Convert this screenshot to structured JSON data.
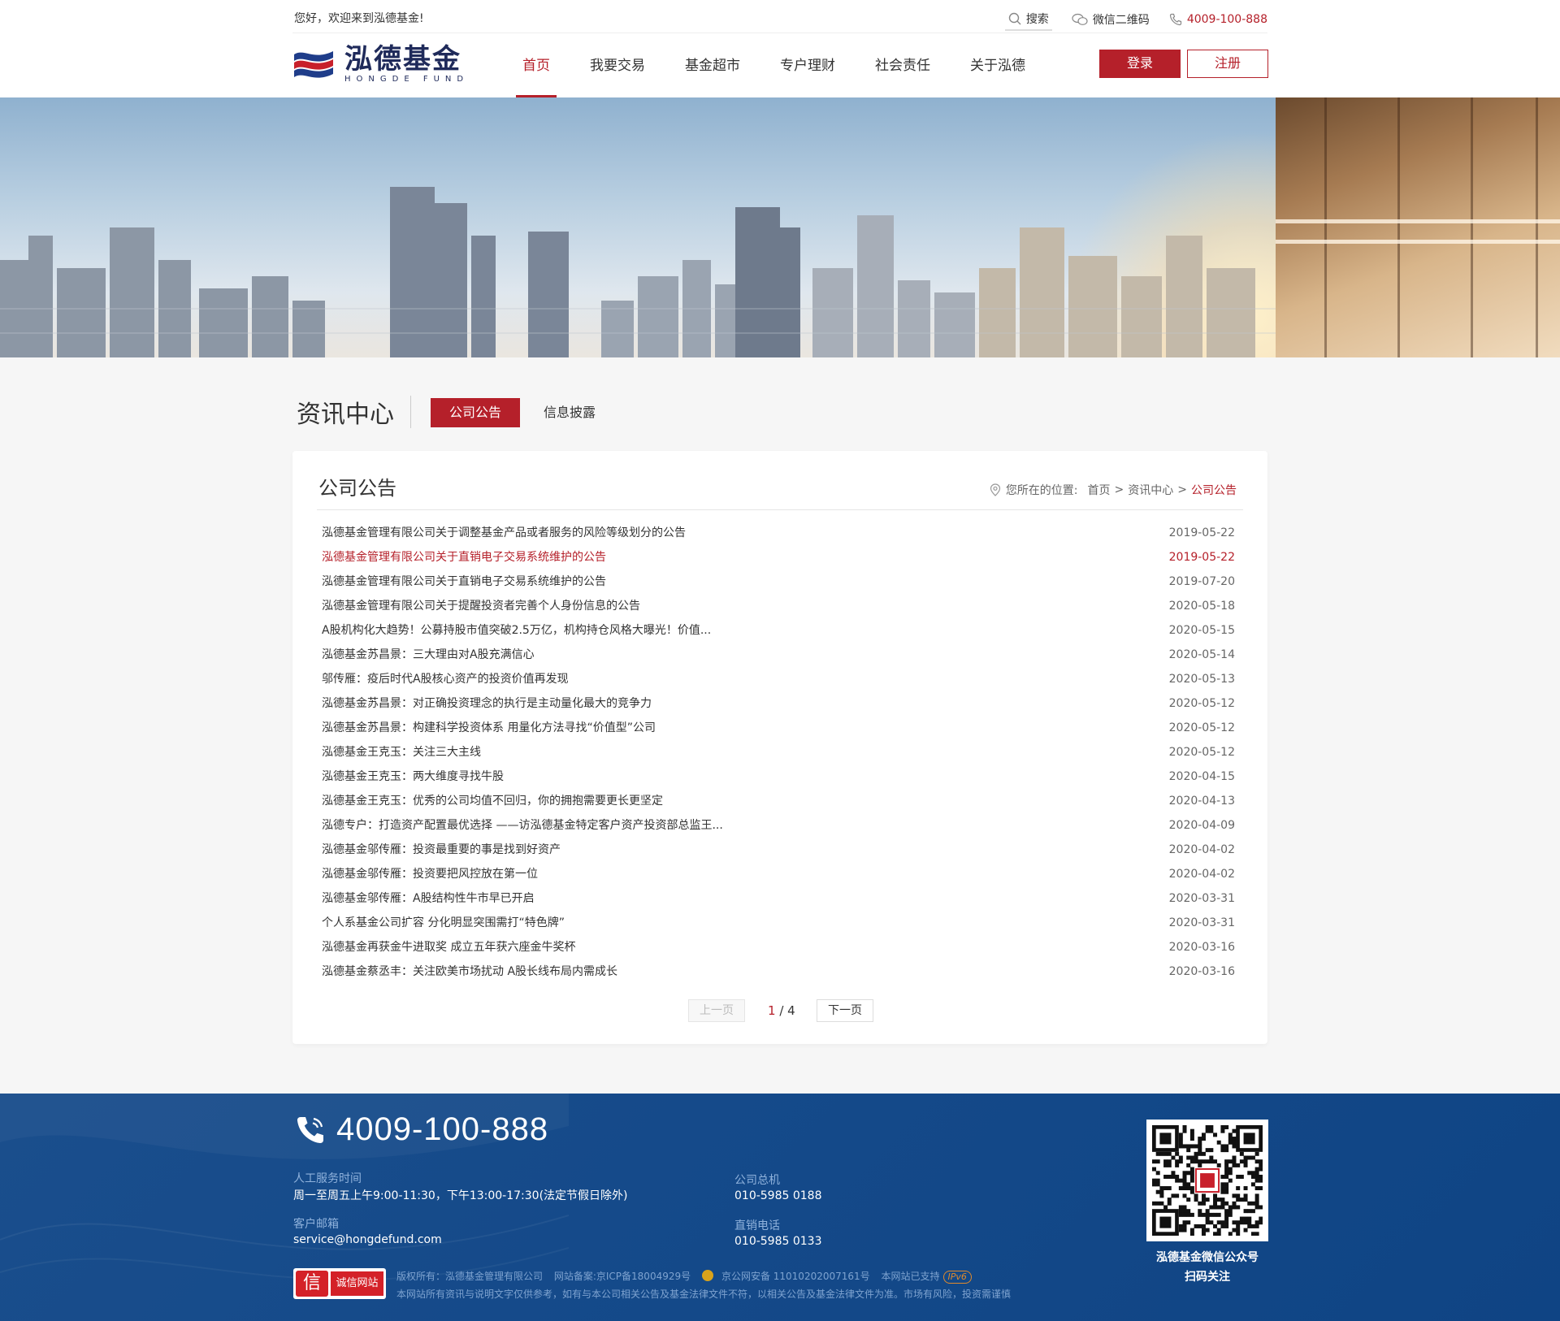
{
  "header": {
    "welcome": "您好，欢迎来到泓德基金!",
    "search_label": "搜索",
    "wechat_label": "微信二维码",
    "phone": "4009-100-888",
    "logo_cn": "泓德基金",
    "logo_en": "HONGDE FUND",
    "nav": [
      "首页",
      "我要交易",
      "基金超市",
      "专户理财",
      "社会责任",
      "关于泓德"
    ],
    "active_nav": "首页",
    "login_label": "登录",
    "register_label": "注册",
    "accent_color": "#b5202a"
  },
  "section": {
    "title": "资讯中心",
    "tabs": [
      "公司公告",
      "信息披露"
    ]
  },
  "card": {
    "title": "公司公告",
    "breadcrumb": {
      "prefix": "您所在的位置:",
      "home": "首页",
      "sep": ">",
      "middle": "资讯中心",
      "current": "公司公告"
    },
    "items": [
      {
        "title": "泓德基金管理有限公司关于调整基金产品或者服务的风险等级划分的公告",
        "date": "2019-05-22"
      },
      {
        "title": "泓德基金管理有限公司关于直销电子交易系统维护的公告",
        "date": "2019-05-22"
      },
      {
        "title": "泓德基金管理有限公司关于直销电子交易系统维护的公告",
        "date": "2019-07-20"
      },
      {
        "title": "泓德基金管理有限公司关于提醒投资者完善个人身份信息的公告",
        "date": "2020-05-18"
      },
      {
        "title": "A股机构化大趋势！公募持股市值突破2.5万亿，机构持仓风格大曝光！价值...",
        "date": "2020-05-15"
      },
      {
        "title": "泓德基金苏昌景：三大理由对A股充满信心",
        "date": "2020-05-14"
      },
      {
        "title": "邬传雁：疫后时代A股核心资产的投资价值再发现",
        "date": "2020-05-13"
      },
      {
        "title": "泓德基金苏昌景：对正确投资理念的执行是主动量化最大的竞争力",
        "date": "2020-05-12"
      },
      {
        "title": "泓德基金苏昌景：构建科学投资体系 用量化方法寻找“价值型”公司",
        "date": "2020-05-12"
      },
      {
        "title": "泓德基金王克玉：关注三大主线",
        "date": "2020-05-12"
      },
      {
        "title": "泓德基金王克玉：两大维度寻找牛股",
        "date": "2020-04-15"
      },
      {
        "title": "泓德基金王克玉：优秀的公司均值不回归，你的拥抱需要更长更坚定",
        "date": "2020-04-13"
      },
      {
        "title": "泓德专户：打造资产配置最优选择 ——访泓德基金特定客户资产投资部总监王...",
        "date": "2020-04-09"
      },
      {
        "title": "泓德基金邬传雁：投资最重要的事是找到好资产",
        "date": "2020-04-02"
      },
      {
        "title": "泓德基金邬传雁：投资要把风控放在第一位",
        "date": "2020-04-02"
      },
      {
        "title": "泓德基金邬传雁：A股结构性牛市早已开启",
        "date": "2020-03-31"
      },
      {
        "title": "个人系基金公司扩容 分化明显突围需打“特色牌”",
        "date": "2020-03-31"
      },
      {
        "title": "泓德基金再获金牛进取奖 成立五年获六座金牛奖杯",
        "date": "2020-03-16"
      },
      {
        "title": "泓德基金蔡丞丰：关注欧美市场扰动 A股长线布局内需成长",
        "date": "2020-03-16"
      }
    ],
    "highlighted_index": 1,
    "pager": {
      "prev": "上一页",
      "current": "1",
      "sep": " / ",
      "total": "4",
      "next": "下一页"
    }
  },
  "footer": {
    "phone": "4009-100-888",
    "service_hours_label": "人工服务时间",
    "service_hours": "周一至周五上午9:00-11:30，下午13:00-17:30(法定节假日除外)",
    "email_label": "客户邮箱",
    "email": "service@hongdefund.com",
    "switchboard_label": "公司总机",
    "switchboard": "010-5985 0188",
    "direct_label": "直销电话",
    "direct": "010-5985 0133",
    "badge_icon_char": "信",
    "badge_text": "诚信网站",
    "copyright": "版权所有：泓德基金管理有限公司",
    "icp": "网站备案:京ICP备18004929号",
    "police": "京公网安备 11010202007161号",
    "ipv6_text": "本网站已支持",
    "ipv6_badge": "IPv6",
    "disclaimer": "本网站所有资讯与说明文字仅供参考，如有与本公司相关公告及基金法律文件不符，以相关公告及基金法律文件为准。市场有风险，投资需谨慎",
    "qr_caption_1": "泓德基金微信公众号",
    "qr_caption_2": "扫码关注"
  }
}
